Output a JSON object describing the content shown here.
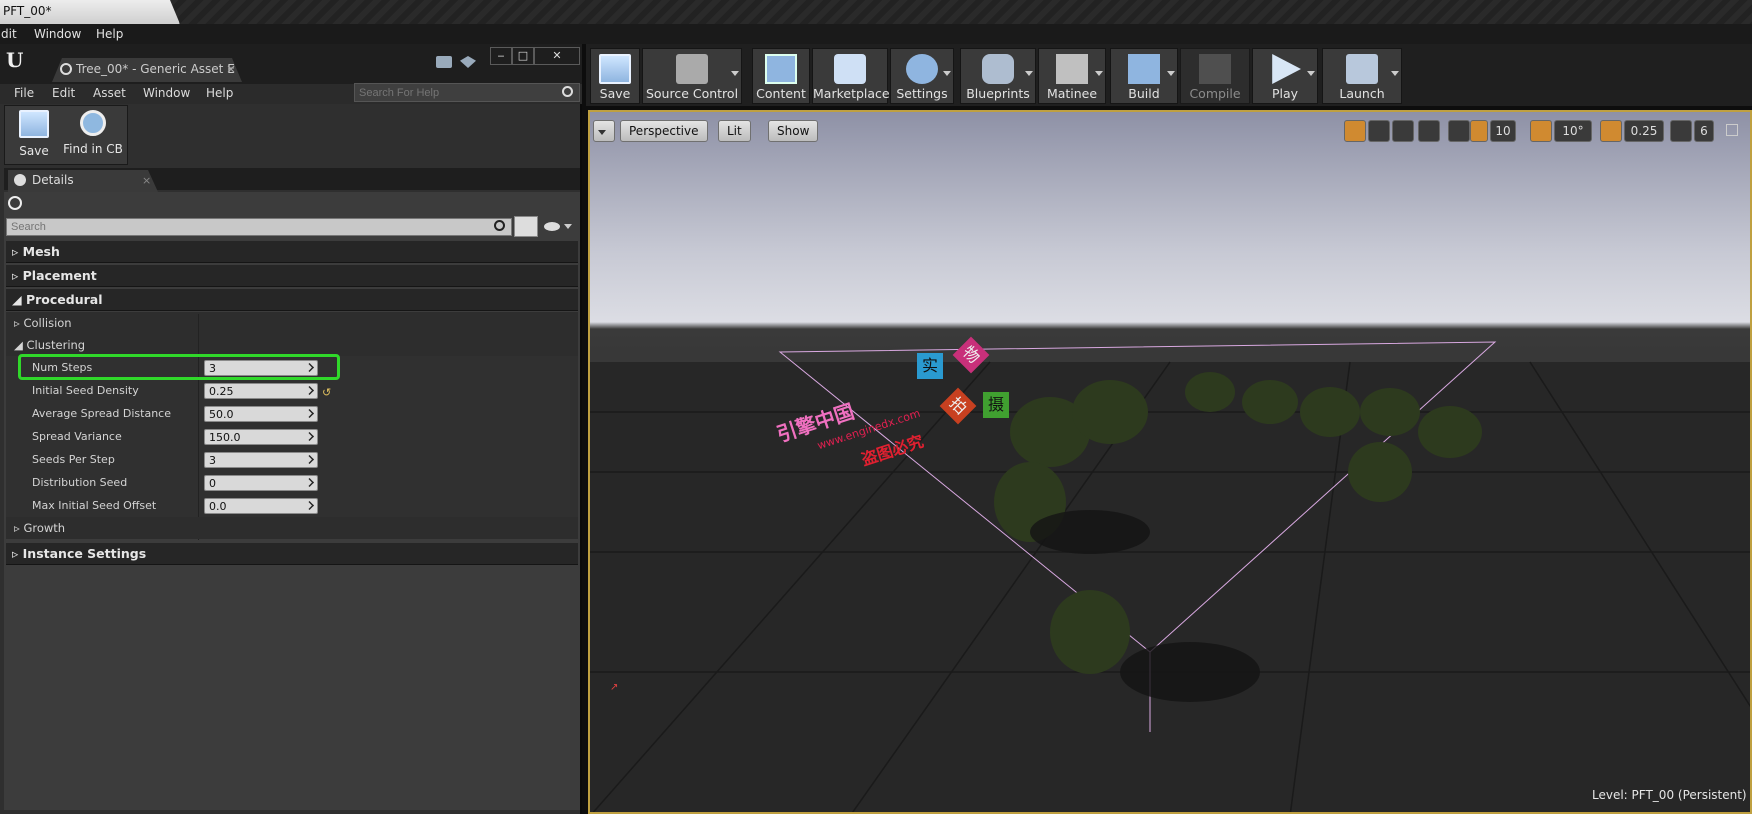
{
  "window_title": "PFT_00*",
  "main_menu": [
    "dit",
    "Window",
    "Help"
  ],
  "asset_tab": {
    "label": "Tree_00* - Generic Asset E",
    "close": "×"
  },
  "editor_menu": [
    "File",
    "Edit",
    "Asset",
    "Window",
    "Help"
  ],
  "help_search": {
    "placeholder": "Search For Help"
  },
  "left_toolbar": {
    "save": "Save",
    "find": "Find in CB"
  },
  "details": {
    "tab": "Details",
    "tab_close": "×",
    "search_placeholder": "Search",
    "categories": {
      "mesh": "Mesh",
      "placement": "Placement",
      "procedural": "Procedural",
      "instance": "Instance Settings"
    },
    "subcategories": {
      "collision": "Collision",
      "clustering": "Clustering",
      "growth": "Growth"
    },
    "properties": [
      {
        "label": "Num Steps",
        "value": "3"
      },
      {
        "label": "Initial Seed Density",
        "value": "0.25"
      },
      {
        "label": "Average Spread Distance",
        "value": "50.0"
      },
      {
        "label": "Spread Variance",
        "value": "150.0"
      },
      {
        "label": "Seeds Per Step",
        "value": "3"
      },
      {
        "label": "Distribution Seed",
        "value": "0"
      },
      {
        "label": "Max Initial Seed Offset",
        "value": "0.0"
      }
    ]
  },
  "main_toolbar": [
    "Save",
    "Source Control",
    "Content",
    "Marketplace",
    "Settings",
    "Blueprints",
    "Matinee",
    "Build",
    "Compile",
    "Play",
    "Launch"
  ],
  "viewport": {
    "perspective": "Perspective",
    "lit": "Lit",
    "show": "Show",
    "grid_snap": "10",
    "rot_snap": "10°",
    "scale_snap": "0.25",
    "cam_speed": "6",
    "level_label": "Level:",
    "level_name": "PFT_00 (Persistent)"
  },
  "watermark": {
    "site": "www.enginedx.com",
    "brand": "引擎中国",
    "rights": "盗图必究",
    "c1": "实",
    "c2": "物",
    "c3": "拍",
    "c4": "摄"
  },
  "colors": {
    "highlight": "#30d82a",
    "viewport_border": "#bfa040",
    "active_snap": "#d08a30"
  }
}
